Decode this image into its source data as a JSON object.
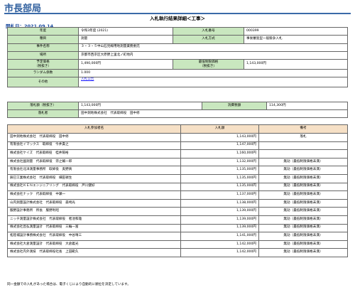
{
  "header": {
    "department": "市長部局",
    "page_title": "入札執行結果詳細＜工事＞",
    "open_date": "開札日：2021.09.14"
  },
  "info": {
    "year_label": "年度",
    "year_value": "令和3年度 (2021)",
    "bid_no_label": "入札番号",
    "bid_no_value": "000399",
    "type_label": "種目",
    "type_value": "測量",
    "method_label": "入札方式",
    "method_value": "事後審査型一般競争入札",
    "project_label": "事件名称",
    "project_value": "３・３・５中山石見線用地測量業務委託",
    "location_label": "場所",
    "location_value": "京都市西京区大原野上里北ノ町地内",
    "planned_price_label": "予定価格",
    "planned_price_sub": "（税抜き）",
    "planned_price_value": "1,490,000円",
    "min_price_label": "最低制限価格",
    "min_price_sub": "（税抜き）",
    "min_price_value": "1,143,000円",
    "random_label": "ランダム係数",
    "random_value": "1.000",
    "other_label": "その他",
    "other_link": "入札公告"
  },
  "award": {
    "amount_label": "落札額（税抜き）",
    "amount_value": "1,143,000円",
    "tax_label": "消費税額",
    "tax_value": "114,300円",
    "winner_label": "落札者",
    "winner_value": "田中測地株式会社　代表取締役　田中修"
  },
  "bids": {
    "col_participant": "入札参加者名",
    "col_amount": "入札額",
    "col_remarks": "備考",
    "rows": [
      {
        "name": "田中測地株式会社　代表取締役　田中修",
        "amount": "1,143,000円",
        "remark": "落札"
      },
      {
        "name": "有限会社イマックス　取締役　今井貴之",
        "amount": "1,147,000円",
        "remark": ""
      },
      {
        "name": "株式会社ケイズ　代表取締役　桂井陽裕",
        "amount": "1,160,000円",
        "remark": ""
      },
      {
        "name": "株式会社國測量　代表取締役　宗之輔一郎",
        "amount": "1,132,000円",
        "remark": "無効（最低制限価格未満）"
      },
      {
        "name": "有限会社北洋測量事務所　取締役　奥野真",
        "amount": "1,135,000円",
        "remark": "無効（最低制限価格未満）"
      },
      {
        "name": "辰巳工業株式会社　代表取締役　細田禎生",
        "amount": "1,135,000円",
        "remark": "無効（最低制限価格未満）"
      },
      {
        "name": "株式会社ＫＥＮエンジニアリング　代表取締役　戸川健好",
        "amount": "1,135,000円",
        "remark": "無効（最低制限価格未満）"
      },
      {
        "name": "株式会社ナック　代表取締役　中瀬一",
        "amount": "1,137,000円",
        "remark": "無効（最低制限価格未満）"
      },
      {
        "name": "山内測量設計株式会社　代表取締役　森崎光",
        "amount": "1,138,000円",
        "remark": "無効（最低制限価格未満）"
      },
      {
        "name": "服野設計事務所　所長　服野利昭",
        "amount": "1,139,000円",
        "remark": "無効（最低制限価格未満）"
      },
      {
        "name": "ニッチ測量設計株式会社　代表取締役　者池和雄",
        "amount": "1,139,000円",
        "remark": "無効（最低制限価格未満）"
      },
      {
        "name": "株式会社昌弘測量設計　代表取締役　三輪一富",
        "amount": "1,139,000円",
        "remark": "無効（最低制限価格未満）"
      },
      {
        "name": "拓陸補設計事務株式会社　代表取締役　中谷晴三",
        "amount": "1,141,000円",
        "remark": "無効（最低制限価格未満）"
      },
      {
        "name": "株式会社大倉測量設計　代表取締役　大倉義光",
        "amount": "1,142,000円",
        "remark": "無効（最低制限価格未満）"
      },
      {
        "name": "株式会社内外測技　代表取締役社長　上田範久",
        "amount": "1,142,000円",
        "remark": "無効（最低制限価格未満）"
      }
    ]
  },
  "footer": {
    "note": "同一金額での入札があった場合は、電子くじにより自動的に順位を決定しています。"
  }
}
